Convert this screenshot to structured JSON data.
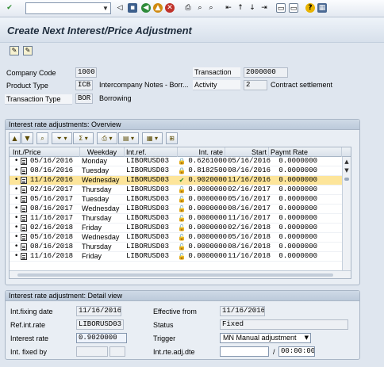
{
  "window": {
    "title": "Create Next Interest/Price Adjustment",
    "command_field": ""
  },
  "header": {
    "company_code_label": "Company Code",
    "company_code": "1000",
    "transaction_label": "Transaction",
    "transaction": "2000000",
    "product_type_label": "Product Type",
    "product_type": "ICB",
    "product_type_text": "Intercompany Notes - Borr...",
    "activity_label": "Activity",
    "activity": "2",
    "activity_text": "Contract settlement",
    "transaction_type_label": "Transaction Type",
    "transaction_type": "BOR",
    "transaction_type_text": "Borrowing"
  },
  "overview": {
    "title": "Interest rate adjustments: Overview",
    "columns": [
      "Int./Price",
      "Weekday",
      "Int.ref.",
      "Int. rate",
      "Start",
      "Paymt Rate"
    ],
    "rows": [
      {
        "date": "05/16/2016",
        "weekday": "Monday",
        "ref": "LIBORUSD03",
        "rate": "0.6261000",
        "start": "05/16/2016",
        "paymt": "0.0000000",
        "selected": false,
        "status_icon": "lock-icon"
      },
      {
        "date": "08/16/2016",
        "weekday": "Tuesday",
        "ref": "LIBORUSD03",
        "rate": "0.8182500",
        "start": "08/16/2016",
        "paymt": "0.0000000",
        "selected": false,
        "status_icon": "lock-icon"
      },
      {
        "date": "11/16/2016",
        "weekday": "Wednesday",
        "ref": "LIBORUSD03",
        "rate": "0.9020000",
        "start": "11/16/2016",
        "paymt": "0.0000000",
        "selected": true,
        "status_icon": "check-icon"
      },
      {
        "date": "02/16/2017",
        "weekday": "Thursday",
        "ref": "LIBORUSD03",
        "rate": "0.0000000",
        "start": "02/16/2017",
        "paymt": "0.0000000",
        "selected": false,
        "status_icon": "unlock-icon"
      },
      {
        "date": "05/16/2017",
        "weekday": "Tuesday",
        "ref": "LIBORUSD03",
        "rate": "0.0000000",
        "start": "05/16/2017",
        "paymt": "0.0000000",
        "selected": false,
        "status_icon": "unlock-icon"
      },
      {
        "date": "08/16/2017",
        "weekday": "Wednesday",
        "ref": "LIBORUSD03",
        "rate": "0.0000000",
        "start": "08/16/2017",
        "paymt": "0.0000000",
        "selected": false,
        "status_icon": "unlock-icon"
      },
      {
        "date": "11/16/2017",
        "weekday": "Thursday",
        "ref": "LIBORUSD03",
        "rate": "0.0000000",
        "start": "11/16/2017",
        "paymt": "0.0000000",
        "selected": false,
        "status_icon": "unlock-icon"
      },
      {
        "date": "02/16/2018",
        "weekday": "Friday",
        "ref": "LIBORUSD03",
        "rate": "0.0000000",
        "start": "02/16/2018",
        "paymt": "0.0000000",
        "selected": false,
        "status_icon": "unlock-icon"
      },
      {
        "date": "05/16/2018",
        "weekday": "Wednesday",
        "ref": "LIBORUSD03",
        "rate": "0.0000000",
        "start": "05/16/2018",
        "paymt": "0.0000000",
        "selected": false,
        "status_icon": "unlock-icon"
      },
      {
        "date": "08/16/2018",
        "weekday": "Thursday",
        "ref": "LIBORUSD03",
        "rate": "0.0000000",
        "start": "08/16/2018",
        "paymt": "0.0000000",
        "selected": false,
        "status_icon": "unlock-icon"
      },
      {
        "date": "11/16/2018",
        "weekday": "Friday",
        "ref": "LIBORUSD03",
        "rate": "0.0000000",
        "start": "11/16/2018",
        "paymt": "0.0000000",
        "selected": false,
        "status_icon": "unlock-icon"
      }
    ]
  },
  "detail": {
    "title": "Interest rate adjustment: Detail view",
    "fixing_date_label": "Int.fixing date",
    "fixing_date": "11/16/2016",
    "effective_from_label": "Effective from",
    "effective_from": "11/16/2016",
    "ref_rate_label": "Ref.int.rate",
    "ref_rate": "LIBORUSD03",
    "status_label": "Status",
    "status": "Fixed",
    "interest_rate_label": "Interest rate",
    "interest_rate": "0.9020000",
    "trigger_label": "Trigger",
    "trigger": "MN Manual adjustment",
    "fixed_by_label": "Int. fixed by",
    "fixed_by": "",
    "adj_date_label": "Int.rte.adj.dte",
    "adj_date": "",
    "adj_time_sep": "/",
    "adj_time": "00:00:00"
  }
}
